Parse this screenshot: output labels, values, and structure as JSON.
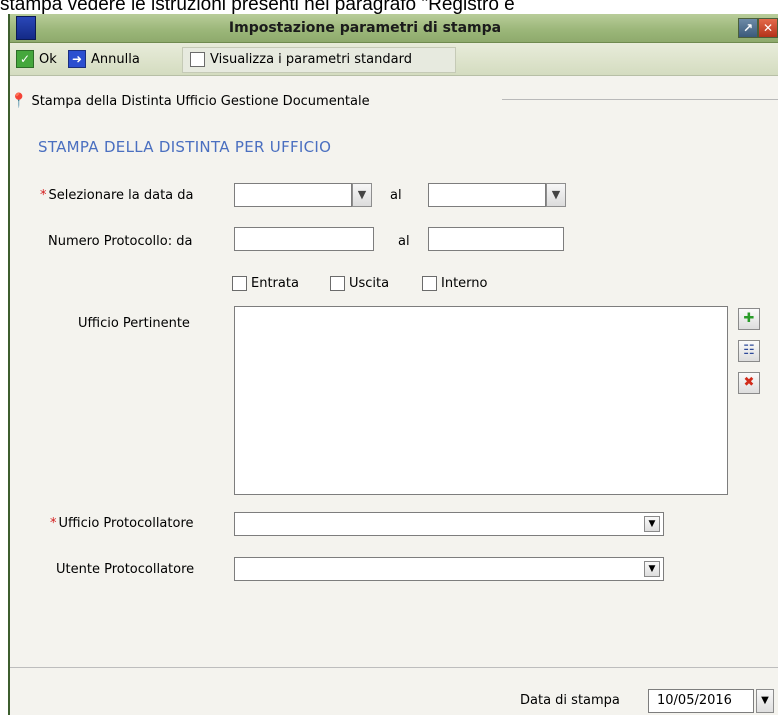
{
  "document_text": "stampa vedere le istruzioni presenti nel paragrafo \"Registro e",
  "window": {
    "title": "Impostazione parametri di stampa"
  },
  "toolbar": {
    "ok_label": "Ok",
    "cancel_label": "Annulla",
    "standard_params_label": "Visualizza i parametri standard"
  },
  "section": {
    "title": "Stampa della Distinta Ufficio Gestione Documentale"
  },
  "form": {
    "heading": "STAMPA DELLA DISTINTA PER UFFICIO",
    "required_marker": "*",
    "date_from_label": "Selezionare la data da",
    "date_to_label": "al",
    "protocol_from_label": "Numero Protocollo:  da",
    "protocol_to_label": "al",
    "checkbox_entrata": "Entrata",
    "checkbox_uscita": "Uscita",
    "checkbox_interno": "Interno",
    "ufficio_pertinente_label": "Ufficio Pertinente",
    "ufficio_protocollatore_label": "Ufficio Protocollatore",
    "utente_protocollatore_label": "Utente Protocollatore"
  },
  "footer": {
    "print_date_label": "Data di stampa",
    "print_date_value": "10/05/2016"
  },
  "icons": {
    "ok": "check-icon",
    "cancel": "arrow-right-icon",
    "add": "plus-icon",
    "tree": "tree-icon",
    "remove": "delete-icon",
    "pin": "pin-icon"
  },
  "colors": {
    "titlebar": "#9cb77a",
    "heading": "#4a6fc0",
    "required": "#d31a1a"
  }
}
